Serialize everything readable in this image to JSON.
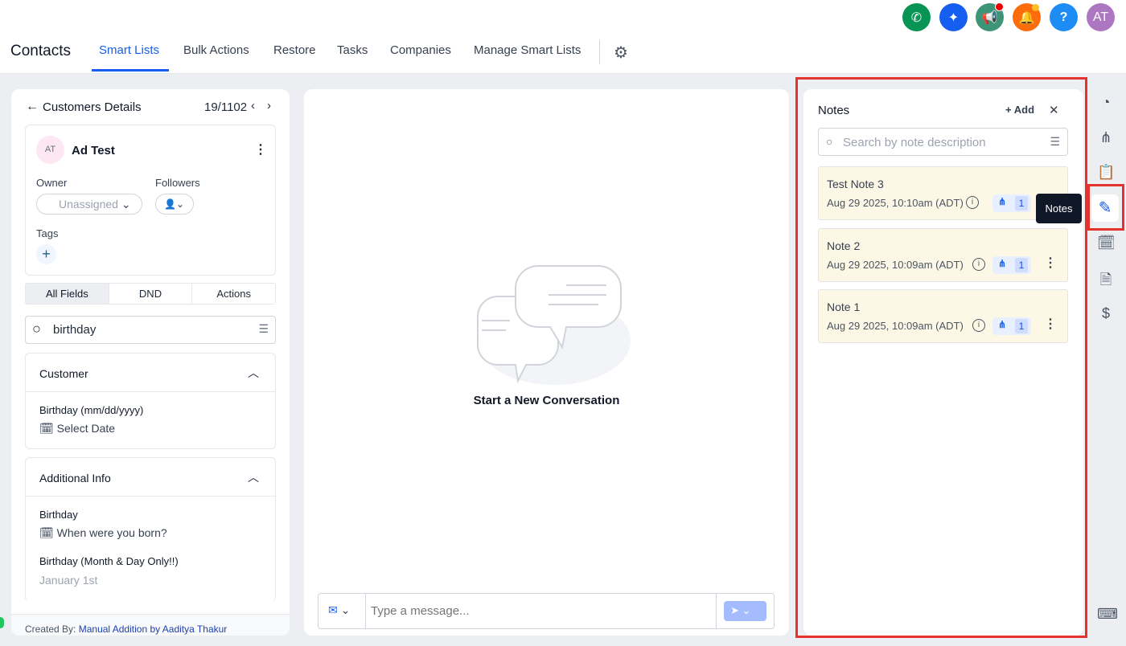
{
  "header": {
    "title": "Contacts",
    "tabs": [
      "Smart Lists",
      "Bulk Actions",
      "Restore",
      "Tasks",
      "Companies",
      "Manage Smart Lists"
    ],
    "avatar": "AT"
  },
  "left": {
    "title": "Customers Details",
    "pager": "19/1102",
    "contact_initials": "AT",
    "contact_name": "Ad Test",
    "owner_label": "Owner",
    "owner_value": "Unassigned",
    "followers_label": "Followers",
    "tags_label": "Tags",
    "tabs": [
      "All Fields",
      "DND",
      "Actions"
    ],
    "search_value": "birthday",
    "sections": [
      {
        "title": "Customer",
        "fields": [
          {
            "label": "Birthday (mm/dd/yyyy)",
            "value": "Select Date"
          }
        ]
      },
      {
        "title": "Additional Info",
        "fields": [
          {
            "label": "Birthday",
            "value": "When were you born?"
          },
          {
            "label": "Birthday (Month & Day Only!!)",
            "value": "January 1st"
          }
        ]
      }
    ],
    "created_by_label": "Created By:",
    "created_by_value": "Manual Addition by Aaditya Thakur"
  },
  "conversation": {
    "empty_title": "Start a New Conversation",
    "placeholder": "Type a message..."
  },
  "notes": {
    "title": "Notes",
    "add_label": "Add",
    "search_placeholder": "Search by note description",
    "tooltip": "Notes",
    "items": [
      {
        "title": "Test Note 3",
        "date": "Aug 29 2025, 10:10am (ADT)",
        "count": "1"
      },
      {
        "title": "Note 2",
        "date": "Aug 29 2025, 10:09am (ADT)",
        "count": "1"
      },
      {
        "title": "Note 1",
        "date": "Aug 29 2025, 10:09am (ADT)",
        "count": "1"
      }
    ]
  },
  "colors": {
    "accent": "#155eef",
    "highlight": "#e5322d"
  }
}
